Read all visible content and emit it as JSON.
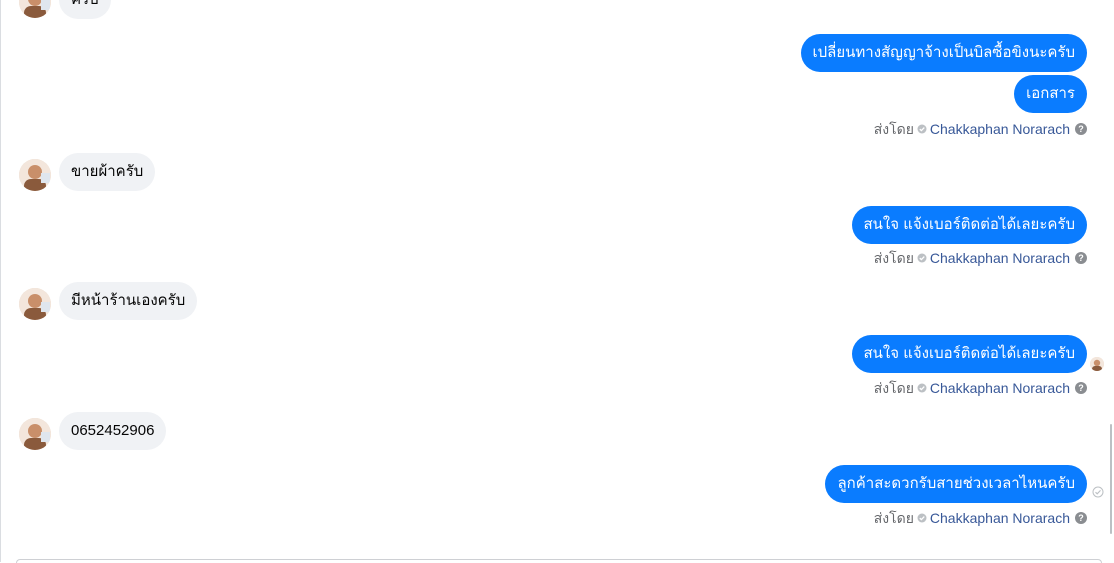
{
  "messages": {
    "top_partial": "ครับ",
    "out_1": "เปลี่ยนทางสัญญาจ้างเป็นบิลซื้อขิงนะครับ",
    "out_2": "เอกสาร",
    "in_1": "ขายผ้าครับ",
    "out_3": "สนใจ แจ้งเบอร์ติดต่อได้เลยะครับ",
    "in_2": "มีหน้าร้านเองครับ",
    "out_4": "สนใจ แจ้งเบอร์ติดต่อได้เลยะครับ",
    "in_3": "0652452906",
    "out_5": "ลูกค้าสะดวกรับสายช่วงเวลาไหนครับ"
  },
  "sent_by": {
    "prefix": "ส่งโดย",
    "name": "Chakkaphan Norarach"
  },
  "colors": {
    "outgoing_bubble": "#0a7cff",
    "incoming_bubble": "#f0f2f5",
    "sender_name": "#385898",
    "meta_text": "#65676b"
  },
  "icons": {
    "verified": "verified-icon",
    "help": "help-icon",
    "delivered": "delivered-check-icon",
    "avatar": "avatar"
  }
}
